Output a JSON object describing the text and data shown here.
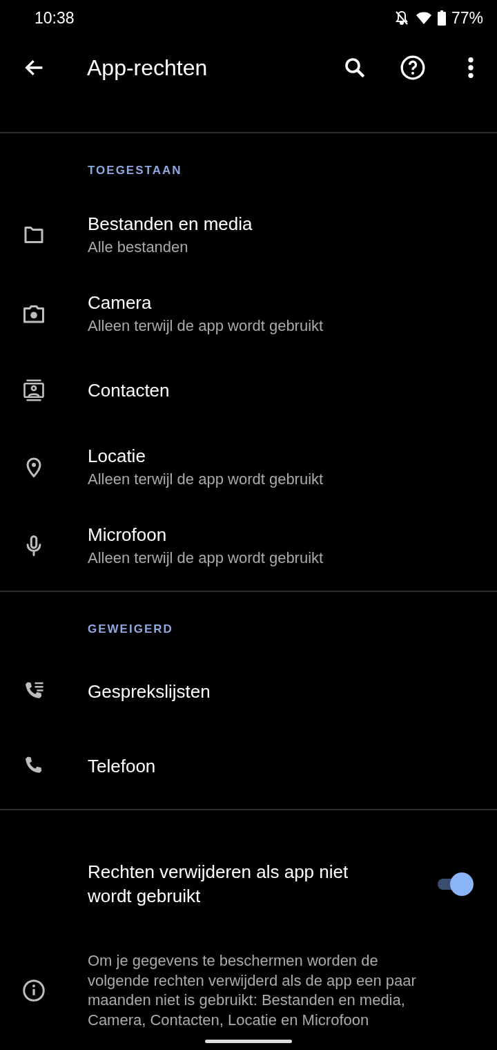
{
  "status_bar": {
    "time": "10:38",
    "battery": "77%"
  },
  "toolbar": {
    "title": "App-rechten"
  },
  "sections": [
    {
      "header": "TOEGESTAAN",
      "items": [
        {
          "kind": "folder",
          "title": "Bestanden en media",
          "subtitle": "Alle bestanden"
        },
        {
          "kind": "camera",
          "title": "Camera",
          "subtitle": "Alleen terwijl de app wordt gebruikt"
        },
        {
          "kind": "contacts",
          "title": "Contacten"
        },
        {
          "kind": "location",
          "title": "Locatie",
          "subtitle": "Alleen terwijl de app wordt gebruikt"
        },
        {
          "kind": "mic",
          "title": "Microfoon",
          "subtitle": "Alleen terwijl de app wordt gebruikt"
        }
      ]
    },
    {
      "header": "GEWEIGERD",
      "items": [
        {
          "kind": "calllog",
          "title": "Gesprekslijsten"
        },
        {
          "kind": "phone",
          "title": "Telefoon"
        }
      ]
    }
  ],
  "auto_revoke": {
    "label": "Rechten verwijderen als app niet wordt gebruikt",
    "on": true
  },
  "info": "Om je gegevens te beschermen worden de volgende rechten verwijderd als de app een paar maanden niet is gebruikt: Bestanden en media, Camera, Contacten, Locatie en Microfoon"
}
